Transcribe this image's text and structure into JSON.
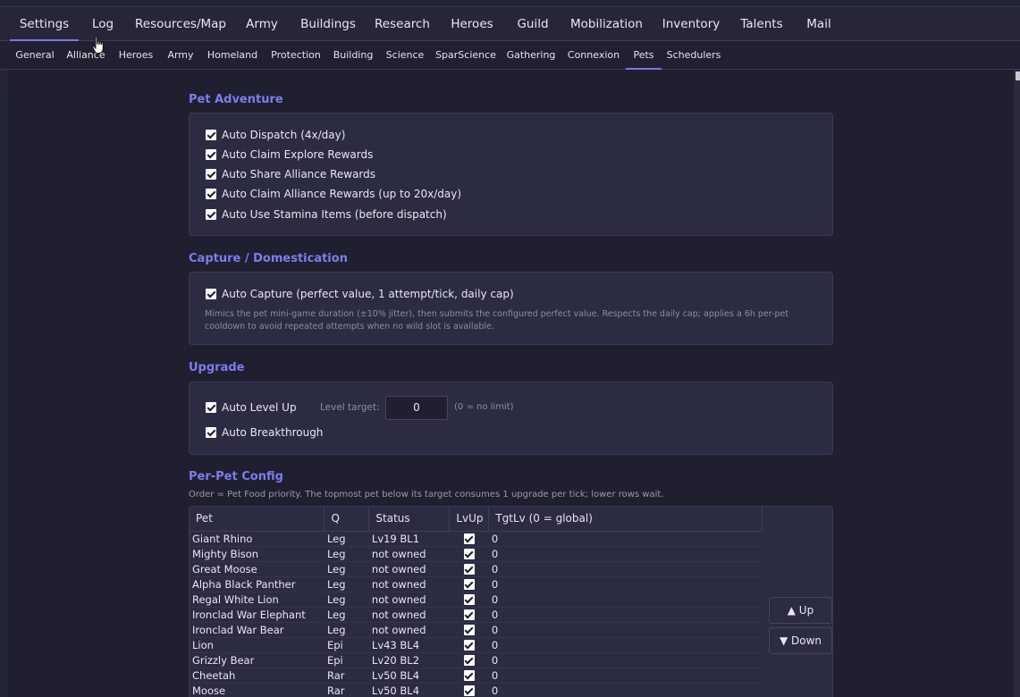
{
  "main_tabs": [
    {
      "label": "Settings",
      "active": true
    },
    {
      "label": "Log"
    },
    {
      "label": "Resources/Map"
    },
    {
      "label": "Army"
    },
    {
      "label": "Buildings"
    },
    {
      "label": "Research"
    },
    {
      "label": "Heroes"
    },
    {
      "label": "Guild"
    },
    {
      "label": "Mobilization"
    },
    {
      "label": "Inventory"
    },
    {
      "label": "Talents"
    },
    {
      "label": "Mail"
    }
  ],
  "sub_tabs": [
    {
      "label": "General"
    },
    {
      "label": "Alliance"
    },
    {
      "label": "Heroes"
    },
    {
      "label": "Army"
    },
    {
      "label": "Homeland"
    },
    {
      "label": "Protection"
    },
    {
      "label": "Building"
    },
    {
      "label": "Science"
    },
    {
      "label": "SparScience"
    },
    {
      "label": "Gathering"
    },
    {
      "label": "Connexion"
    },
    {
      "label": "Pets",
      "active": true
    },
    {
      "label": "Schedulers"
    }
  ],
  "pet_adventure": {
    "title": "Pet Adventure",
    "options": [
      {
        "label": "Auto Dispatch (4x/day)",
        "checked": true
      },
      {
        "label": "Auto Claim Explore Rewards",
        "checked": true
      },
      {
        "label": "Auto Share Alliance Rewards",
        "checked": true
      },
      {
        "label": "Auto Claim Alliance Rewards (up to 20x/day)",
        "checked": true
      },
      {
        "label": "Auto Use Stamina Items (before dispatch)",
        "checked": true
      }
    ]
  },
  "capture": {
    "title": "Capture / Domestication",
    "option": {
      "label": "Auto Capture (perfect value, 1 attempt/tick, daily cap)",
      "checked": true
    },
    "hint_line1": "Mimics the pet mini-game duration (±10% jitter), then submits the configured perfect value. Respects the daily cap; applies a 6h per-pet",
    "hint_line2": "cooldown to avoid repeated attempts when no wild slot is available."
  },
  "upgrade": {
    "title": "Upgrade",
    "auto_level_up": {
      "label": "Auto Level Up",
      "checked": true
    },
    "level_target_label": "Level target:",
    "level_target_value": "0",
    "level_target_note": "(0 = no limit)",
    "auto_breakthrough": {
      "label": "Auto Breakthrough",
      "checked": true
    }
  },
  "per_pet": {
    "title": "Per-Pet Config",
    "description": "Order = Pet Food priority. The topmost pet below its target consumes 1 upgrade per tick; lower rows wait.",
    "columns": [
      "Pet",
      "Q",
      "Status",
      "LvUp",
      "TgtLv (0 = global)"
    ],
    "rows": [
      {
        "pet": "Giant Rhino",
        "q": "Leg",
        "status": "Lv19 BL1",
        "lvup": true,
        "tgt": "0"
      },
      {
        "pet": "Mighty Bison",
        "q": "Leg",
        "status": "not owned",
        "lvup": true,
        "tgt": "0"
      },
      {
        "pet": "Great Moose",
        "q": "Leg",
        "status": "not owned",
        "lvup": true,
        "tgt": "0"
      },
      {
        "pet": "Alpha Black Panther",
        "q": "Leg",
        "status": "not owned",
        "lvup": true,
        "tgt": "0"
      },
      {
        "pet": "Regal White Lion",
        "q": "Leg",
        "status": "not owned",
        "lvup": true,
        "tgt": "0"
      },
      {
        "pet": "Ironclad War Elephant",
        "q": "Leg",
        "status": "not owned",
        "lvup": true,
        "tgt": "0"
      },
      {
        "pet": "Ironclad War Bear",
        "q": "Leg",
        "status": "not owned",
        "lvup": true,
        "tgt": "0"
      },
      {
        "pet": "Lion",
        "q": "Epi",
        "status": "Lv43 BL4",
        "lvup": true,
        "tgt": "0"
      },
      {
        "pet": "Grizzly Bear",
        "q": "Epi",
        "status": "Lv20 BL2",
        "lvup": true,
        "tgt": "0"
      },
      {
        "pet": "Cheetah",
        "q": "Rar",
        "status": "Lv50 BL4",
        "lvup": true,
        "tgt": "0"
      },
      {
        "pet": "Moose",
        "q": "Rar",
        "status": "Lv50 BL4",
        "lvup": true,
        "tgt": "0"
      }
    ],
    "up_label": "▲ Up",
    "down_label": "▼ Down"
  }
}
